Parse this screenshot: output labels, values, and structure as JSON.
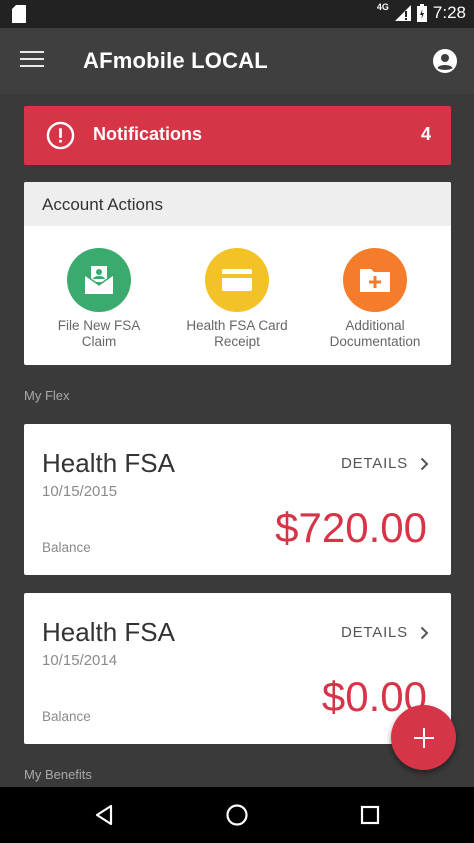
{
  "status_bar": {
    "network": "4G",
    "time": "7:28"
  },
  "app_bar": {
    "title": "AFmobile LOCAL"
  },
  "notifications": {
    "label": "Notifications",
    "count": "4",
    "color": "#d63447"
  },
  "account_actions": {
    "header": "Account Actions",
    "items": [
      {
        "line1": "File New FSA",
        "line2": "Claim",
        "icon": "envelope-photo-icon",
        "color": "#3aaa6f"
      },
      {
        "line1": "Health FSA Card",
        "line2": "Receipt",
        "icon": "card-icon",
        "color": "#f2c227"
      },
      {
        "line1": "Additional",
        "line2": "Documentation",
        "icon": "folder-plus-icon",
        "color": "#f57c2a"
      }
    ]
  },
  "my_flex": {
    "label": "My Flex",
    "accounts": [
      {
        "name": "Health FSA",
        "date": "10/15/2015",
        "details_label": "DETAILS",
        "balance_label": "Balance",
        "amount": "$720.00"
      },
      {
        "name": "Health FSA",
        "date": "10/15/2014",
        "details_label": "DETAILS",
        "balance_label": "Balance",
        "amount": "$0.00"
      }
    ]
  },
  "my_benefits": {
    "label": "My Benefits"
  }
}
